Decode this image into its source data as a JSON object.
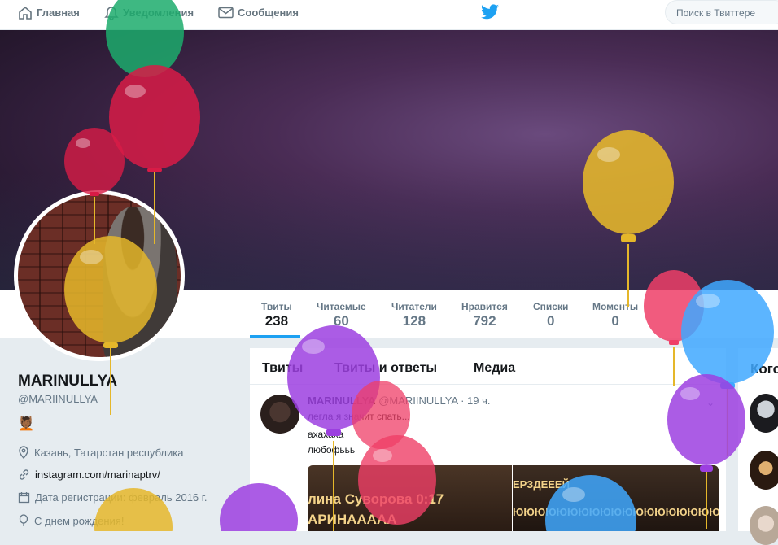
{
  "topnav": {
    "home_label": "Главная",
    "notifications_label": "Уведомления",
    "messages_label": "Сообщения",
    "search_placeholder": "Поиск в Твиттере"
  },
  "stats": [
    {
      "label": "Твиты",
      "value": "238"
    },
    {
      "label": "Читаемые",
      "value": "60"
    },
    {
      "label": "Читатели",
      "value": "128"
    },
    {
      "label": "Нравится",
      "value": "792"
    },
    {
      "label": "Списки",
      "value": "0"
    },
    {
      "label": "Моменты",
      "value": "0"
    }
  ],
  "profile": {
    "name": "MARINULLYA",
    "handle": "@MARIINULLYA",
    "emoji": "💆🏾",
    "location": "Казань, Татарстан республика",
    "website": "instagram.com/marinaptrv/",
    "joined": "Дата регистрации: февраль 2016 г.",
    "birthday": "С днем рождения!"
  },
  "tabs": {
    "tweets": "Твиты",
    "tweets_replies": "Твиты и ответы",
    "media": "Медиа"
  },
  "tweet": {
    "name": "MARINULLYA",
    "handle": "@MARIINULLYA",
    "time": "· 19 ч.",
    "line1": "легла я значит спать...",
    "line2": "ахахаха",
    "line3": "любофььь",
    "media_left_line1": "лина Суворова 0:17",
    "media_left_line2": "АРИНААААА",
    "media_right_line1": "ЕРЗДЕЕЕЙ",
    "media_right_line2": "ЮЮЮЮЮЮЮЮЮЮЮЮЮЮЮЮЮЮЮ"
  },
  "right_panel": {
    "title": "Кого"
  },
  "colors": {
    "accent": "#1da1f2",
    "balloon_red": "#d81b46",
    "balloon_yellow": "#e5b72a",
    "balloon_purple": "#9c3fe0",
    "balloon_blue": "#3fa8ff",
    "balloon_green": "#1cab6c"
  }
}
